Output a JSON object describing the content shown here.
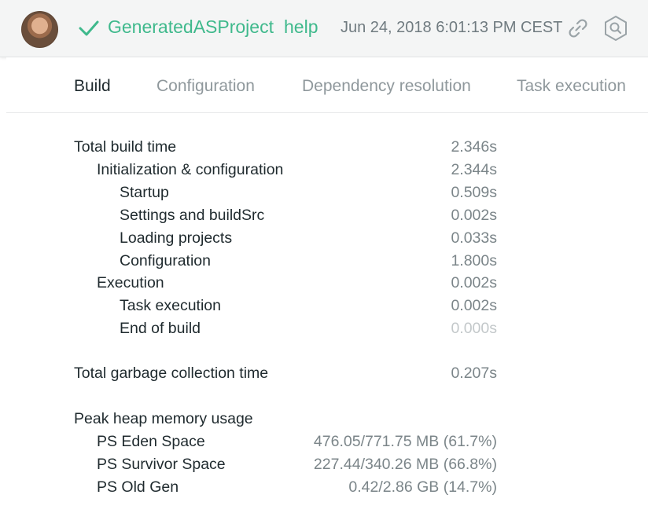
{
  "header": {
    "project_name": "GeneratedASProject",
    "help_label": "help",
    "timestamp": "Jun 24, 2018 6:01:13 PM CEST",
    "status_icon": "check-icon",
    "link_icon": "link-icon",
    "search_icon": "search-icon",
    "accent_color": "#3fb98c"
  },
  "tabs": [
    {
      "label": "Build",
      "active": true
    },
    {
      "label": "Configuration",
      "active": false
    },
    {
      "label": "Dependency resolution",
      "active": false
    },
    {
      "label": "Task execution",
      "active": false
    }
  ],
  "build": {
    "total_build_time": {
      "label": "Total build time",
      "value": "2.346s"
    },
    "init_config": {
      "label": "Initialization & configuration",
      "value": "2.344s"
    },
    "startup": {
      "label": "Startup",
      "value": "0.509s"
    },
    "settings_buildsrc": {
      "label": "Settings and buildSrc",
      "value": "0.002s"
    },
    "loading_projects": {
      "label": "Loading projects",
      "value": "0.033s"
    },
    "configuration": {
      "label": "Configuration",
      "value": "1.800s"
    },
    "execution": {
      "label": "Execution",
      "value": "0.002s"
    },
    "task_execution": {
      "label": "Task execution",
      "value": "0.002s"
    },
    "end_of_build": {
      "label": "End of build",
      "value": "0.000s"
    },
    "gc_time": {
      "label": "Total garbage collection time",
      "value": "0.207s"
    },
    "peak_heap": {
      "label": "Peak heap memory usage"
    },
    "ps_eden": {
      "label": "PS Eden Space",
      "value": "476.05/771.75 MB (61.7%)"
    },
    "ps_survivor": {
      "label": "PS Survivor Space",
      "value": "227.44/340.26 MB (66.8%)"
    },
    "ps_old_gen": {
      "label": "PS Old Gen",
      "value": "0.42/2.86 GB (14.7%)"
    }
  }
}
